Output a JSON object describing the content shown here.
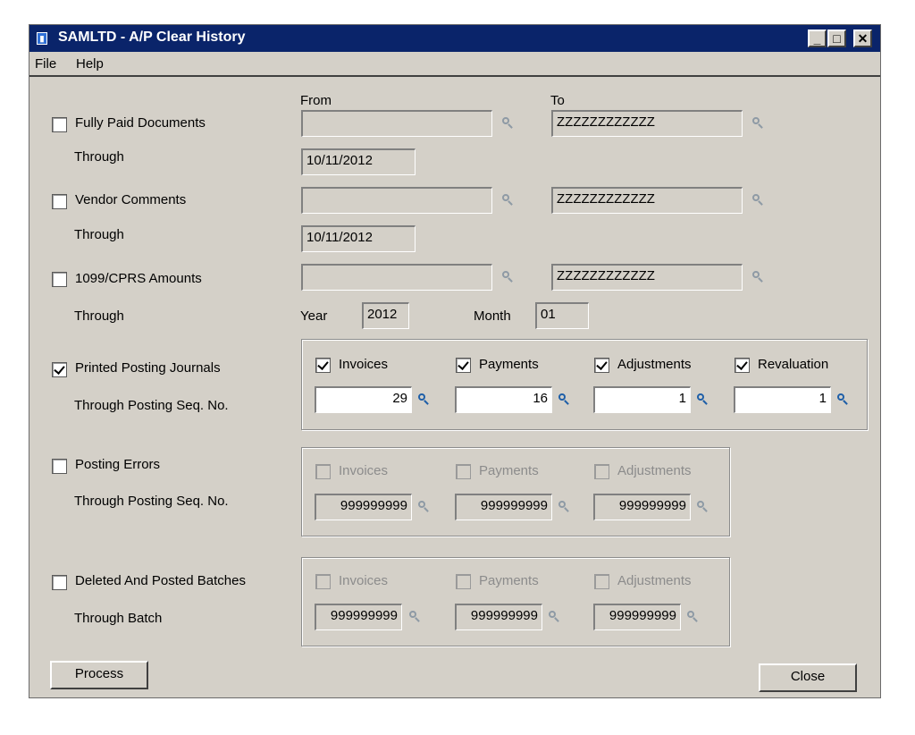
{
  "window": {
    "title": "SAMLTD - A/P Clear History"
  },
  "menu": {
    "file": "File",
    "help": "Help"
  },
  "headers": {
    "from": "From",
    "to": "To"
  },
  "fully_paid": {
    "label": "Fully Paid Documents",
    "checked": false,
    "from": "",
    "to": "ZZZZZZZZZZZZ",
    "through_label": "Through",
    "through": "10/11/2012"
  },
  "vendor_comments": {
    "label": "Vendor Comments",
    "checked": false,
    "from": "",
    "to": "ZZZZZZZZZZZZ",
    "through_label": "Through",
    "through": "10/11/2012"
  },
  "amounts_1099": {
    "label": "1099/CPRS Amounts",
    "checked": false,
    "from": "",
    "to": "ZZZZZZZZZZZZ",
    "through_label": "Through",
    "year_label": "Year",
    "year": "2012",
    "month_label": "Month",
    "month": "01"
  },
  "printed_journals": {
    "label": "Printed Posting Journals",
    "checked": true,
    "through_label": "Through Posting Seq. No.",
    "invoices": {
      "label": "Invoices",
      "checked": true,
      "value": "29"
    },
    "payments": {
      "label": "Payments",
      "checked": true,
      "value": "16"
    },
    "adjustments": {
      "label": "Adjustments",
      "checked": true,
      "value": "1"
    },
    "revaluation": {
      "label": "Revaluation",
      "checked": true,
      "value": "1"
    }
  },
  "posting_errors": {
    "label": "Posting Errors",
    "checked": false,
    "through_label": "Through Posting Seq. No.",
    "invoices": {
      "label": "Invoices",
      "value": "999999999"
    },
    "payments": {
      "label": "Payments",
      "value": "999999999"
    },
    "adjustments": {
      "label": "Adjustments",
      "value": "999999999"
    }
  },
  "deleted_batches": {
    "label": "Deleted And Posted Batches",
    "checked": false,
    "through_label": "Through Batch",
    "invoices": {
      "label": "Invoices",
      "value": "999999999"
    },
    "payments": {
      "label": "Payments",
      "value": "999999999"
    },
    "adjustments": {
      "label": "Adjustments",
      "value": "999999999"
    }
  },
  "buttons": {
    "process": "Process",
    "close": "Close"
  },
  "colors": {
    "titlebar": "#0a246a",
    "face": "#d4d0c8",
    "lookup_active": "#1f5fa8"
  }
}
